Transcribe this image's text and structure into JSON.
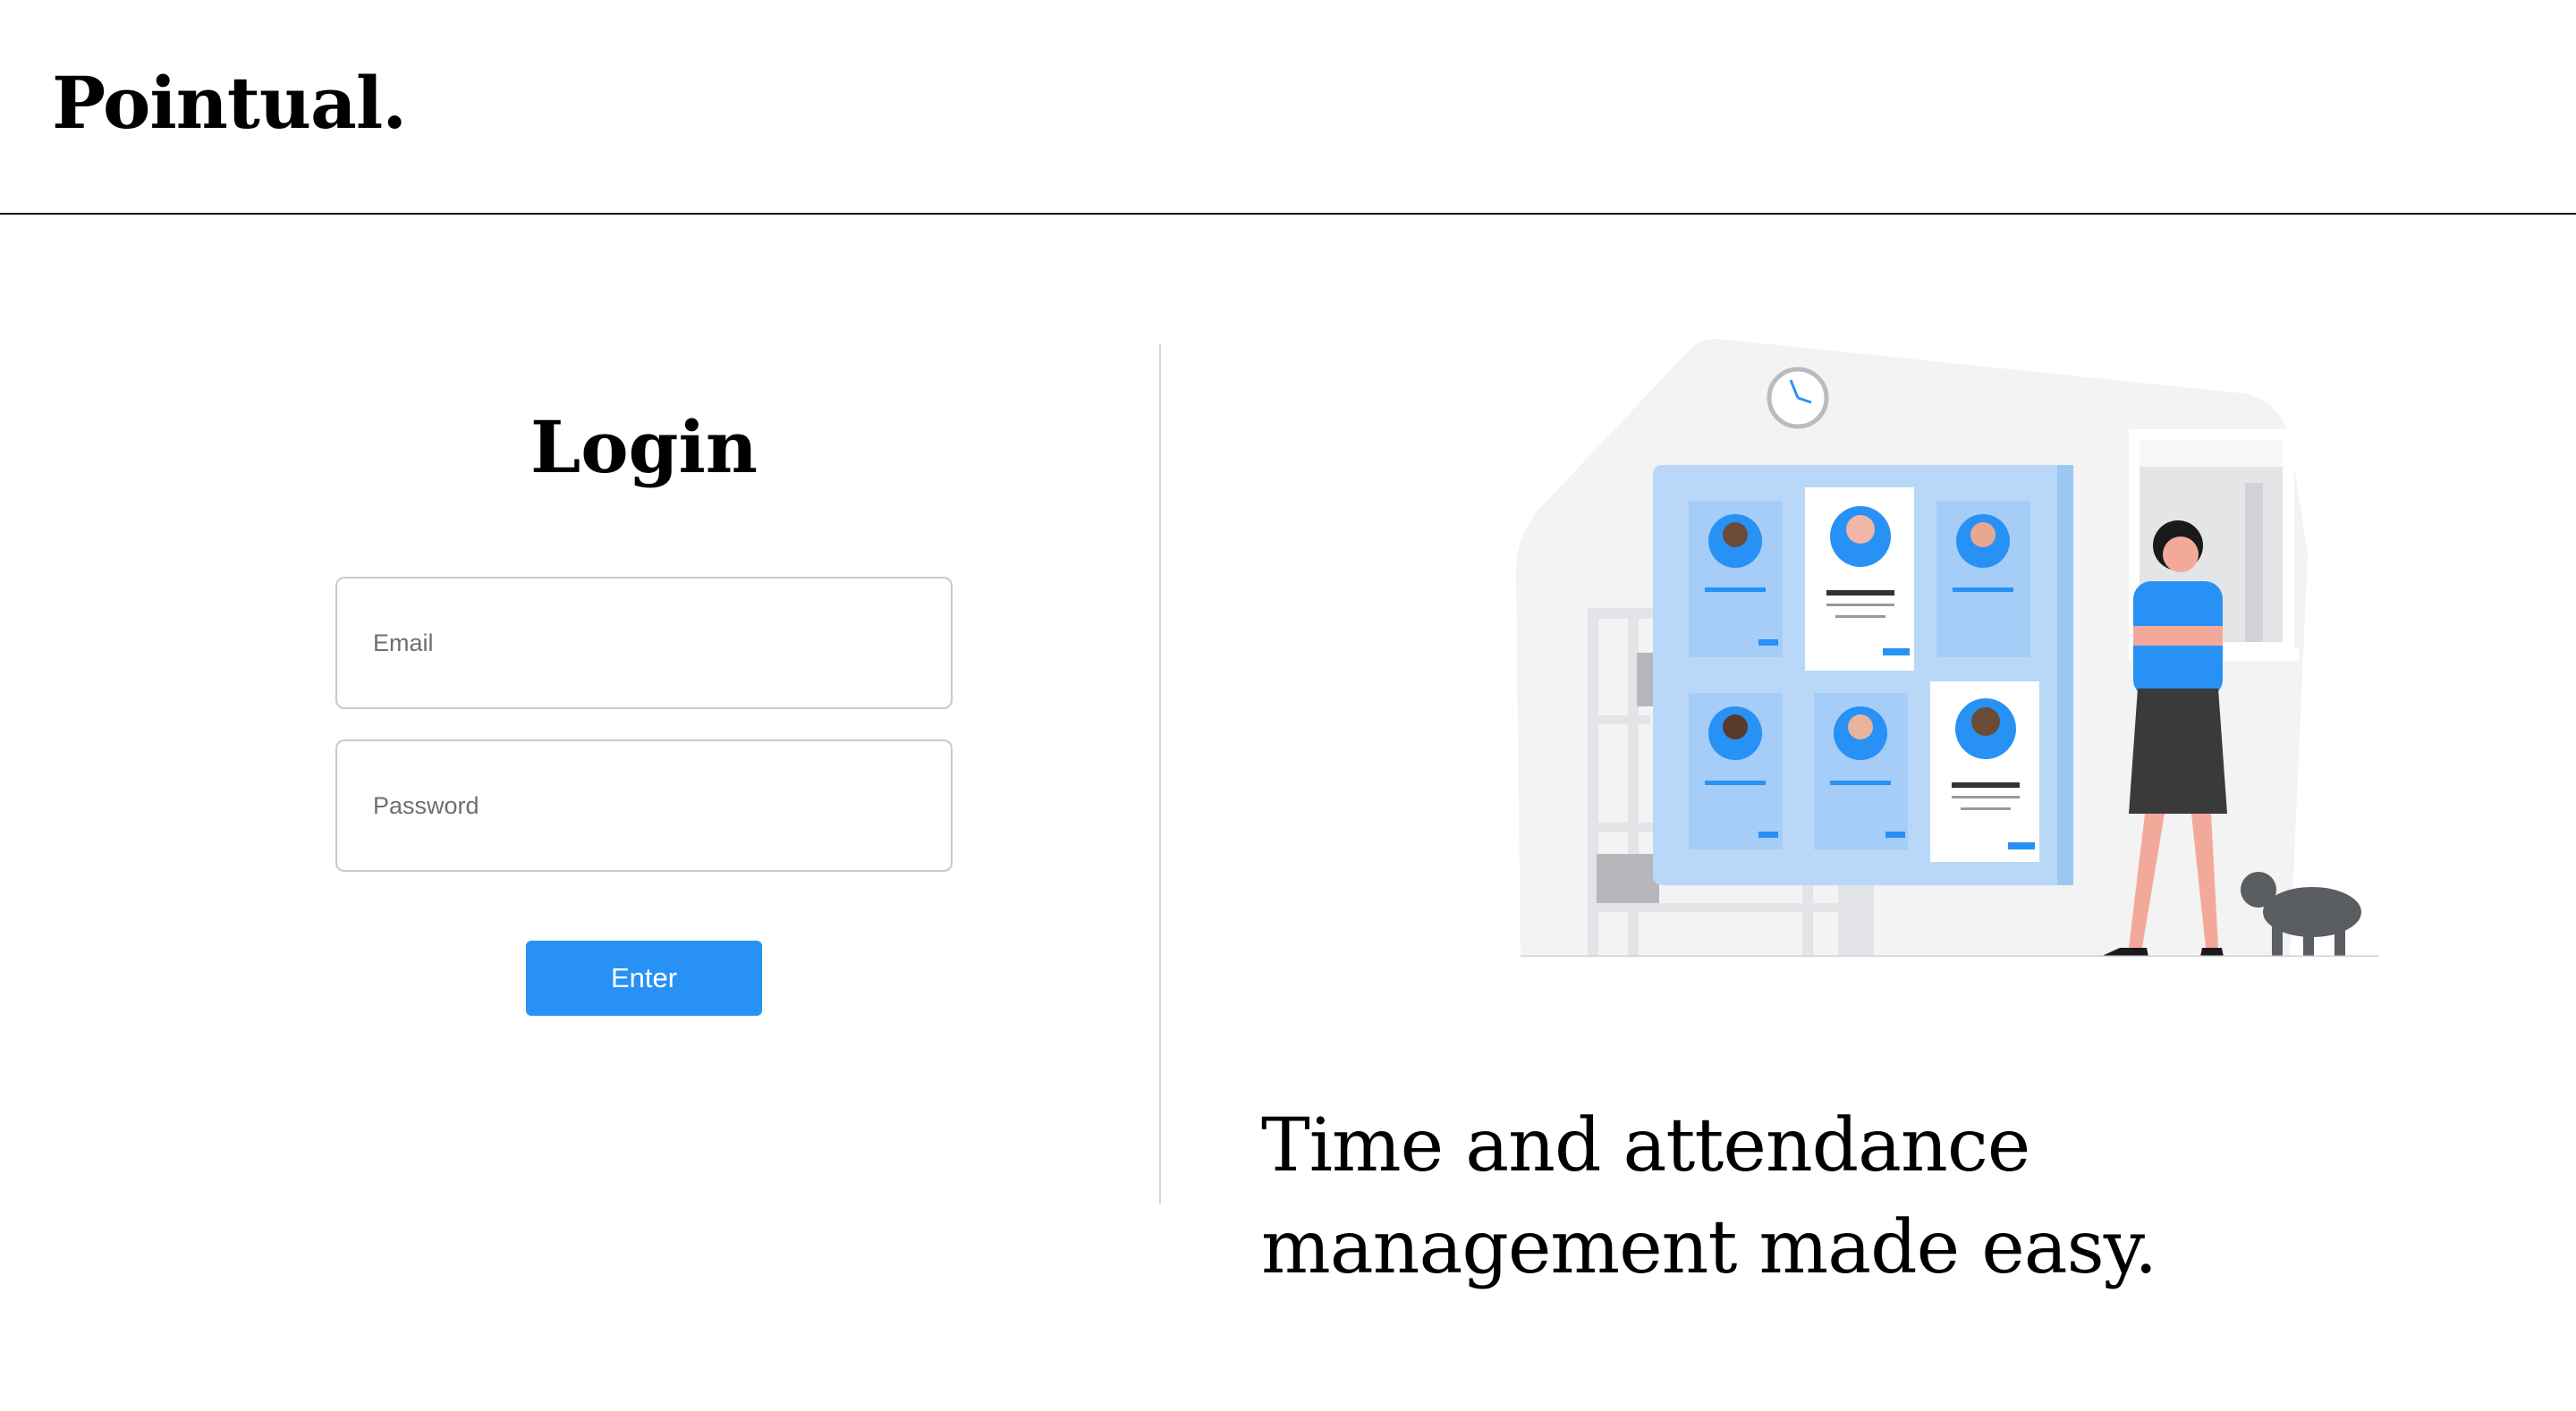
{
  "header": {
    "logo": "Pointual."
  },
  "login": {
    "title": "Login",
    "email_placeholder": "Email",
    "password_placeholder": "Password",
    "enter_label": "Enter"
  },
  "tagline": {
    "line1": "Time and attendance",
    "line2": "management made easy."
  },
  "colors": {
    "accent": "#2891f5",
    "panel": "#b9d8f8",
    "background_shape": "#f3f3f3"
  },
  "icons": {
    "clock": "clock-icon",
    "illustration": "team-schedule-illustration"
  }
}
